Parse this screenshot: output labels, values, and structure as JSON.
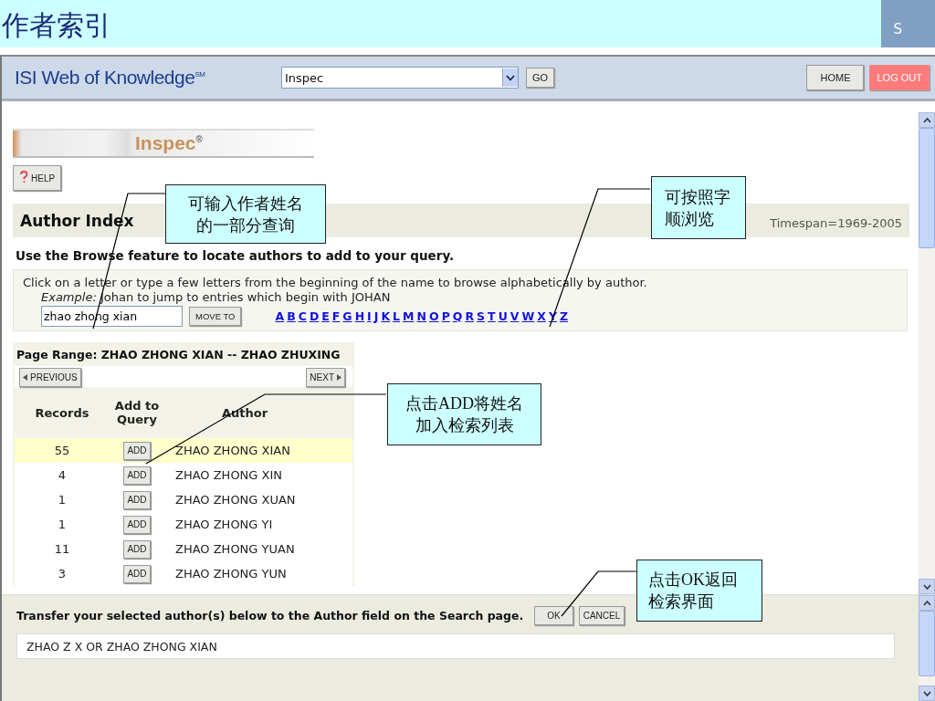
{
  "slide": {
    "title": "作者索引",
    "corner_text": "S"
  },
  "header": {
    "logo": "ISI Web of Knowledge$^{SM}$",
    "database": "Inspec",
    "go": "GO",
    "home": "HOME",
    "logout": "LOG OUT"
  },
  "banner": "Inspec$^{®}$",
  "help": "HELP",
  "section": {
    "title": "Author Index",
    "timespan": "Timespan=1969-2005"
  },
  "instruction": "Use the Browse feature to locate authors to add to your query.",
  "browse": {
    "hint": "Click on a letter or type a few letters from the beginning of the name to browse alphabetically by author.",
    "example": "*Example:* Johan to jump to entries which begin with JOHAN",
    "value": "zhao zhong xian",
    "move_to": "MOVE TO",
    "letters": [
      "A",
      "B",
      "C",
      "D",
      "E",
      "F",
      "G",
      "H",
      "I",
      "J",
      "K",
      "L",
      "M",
      "N",
      "O",
      "P",
      "Q",
      "R",
      "S",
      "T",
      "U",
      "V",
      "W",
      "X",
      "Y",
      "Z"
    ]
  },
  "results": {
    "page_range": "Page Range: ZHAO ZHONG XIAN -- ZHAO ZHUXING",
    "previous": "PREVIOUS",
    "next": "NEXT",
    "columns": [
      "Records",
      "Add to Query",
      "Author"
    ],
    "rows": [
      {
        "records": "55",
        "add": "ADD",
        "author": "ZHAO ZHONG XIAN",
        "selected": true
      },
      {
        "records": "4",
        "add": "ADD",
        "author": "ZHAO ZHONG XIN",
        "selected": false
      },
      {
        "records": "1",
        "add": "ADD",
        "author": "ZHAO ZHONG XUAN",
        "selected": false
      },
      {
        "records": "1",
        "add": "ADD",
        "author": "ZHAO ZHONG YI",
        "selected": false
      },
      {
        "records": "11",
        "add": "ADD",
        "author": "ZHAO ZHONG YUAN",
        "selected": false
      },
      {
        "records": "3",
        "add": "ADD",
        "author": "ZHAO ZHONG YUN",
        "selected": false
      }
    ]
  },
  "transfer": {
    "label": "Transfer your selected author(s) below to the Author field on the Search page.",
    "ok": "OK",
    "cancel": "CANCEL",
    "value": "ZHAO Z X OR ZHAO ZHONG XIAN"
  },
  "callouts": [
    {
      "text": "可输入作者姓名的一部分查询"
    },
    {
      "text": "可按照字顺浏览"
    },
    {
      "text": "点击ADD将姓名加入检索列表"
    },
    {
      "text": "点击OK返回检索界面"
    }
  ]
}
